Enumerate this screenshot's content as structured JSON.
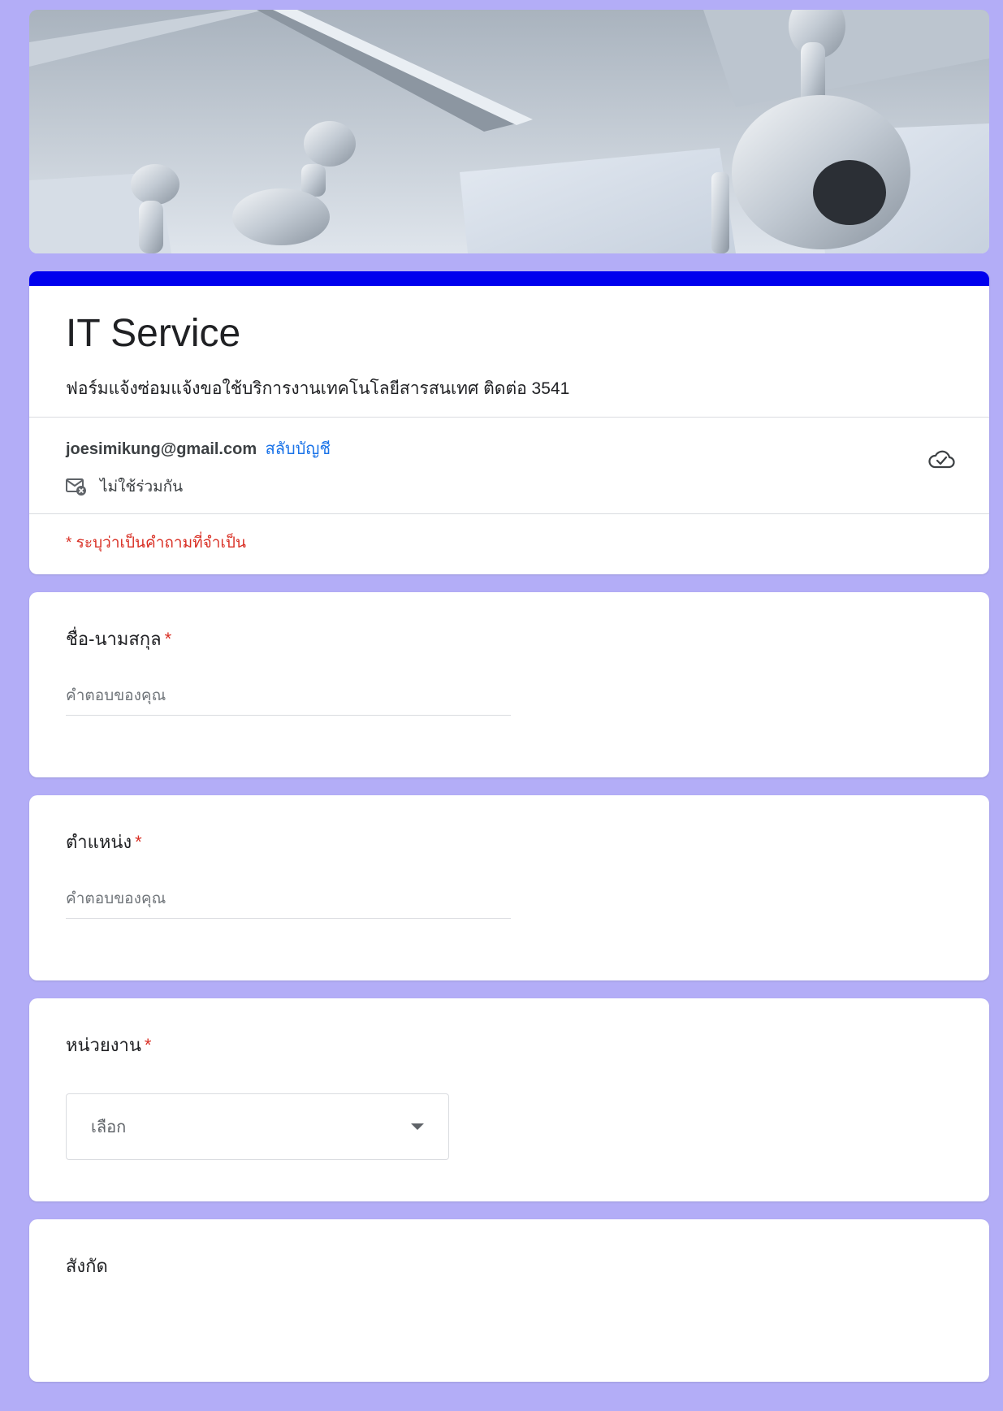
{
  "form": {
    "title": "IT Service",
    "description": "ฟอร์มแจ้งซ่อมแจ้งขอใช้บริการงานเทคโนโลยีสารสนเทศ  ติดต่อ 3541",
    "accent_color": "#0000ee",
    "background_color": "#b3adf7"
  },
  "account": {
    "email": "joesimikung@gmail.com",
    "switch_label": "สลับบัญชี",
    "not_shared_label": "ไม่ใช้ร่วมกัน",
    "icons": {
      "mail": "mail-off-icon",
      "cloud": "cloud-check-icon"
    }
  },
  "required_note": "* ระบุว่าเป็นคำถามที่จำเป็น",
  "questions": [
    {
      "title": "ชื่อ-นามสกุล",
      "required_mark": "*",
      "type": "text",
      "placeholder": "คำตอบของคุณ"
    },
    {
      "title": "ตำแหน่ง",
      "required_mark": "*",
      "type": "text",
      "placeholder": "คำตอบของคุณ"
    },
    {
      "title": "หน่วยงาน",
      "required_mark": "*",
      "type": "select",
      "selected": "เลือก"
    },
    {
      "title": "สังกัด",
      "required_mark": "",
      "type": "text"
    }
  ]
}
